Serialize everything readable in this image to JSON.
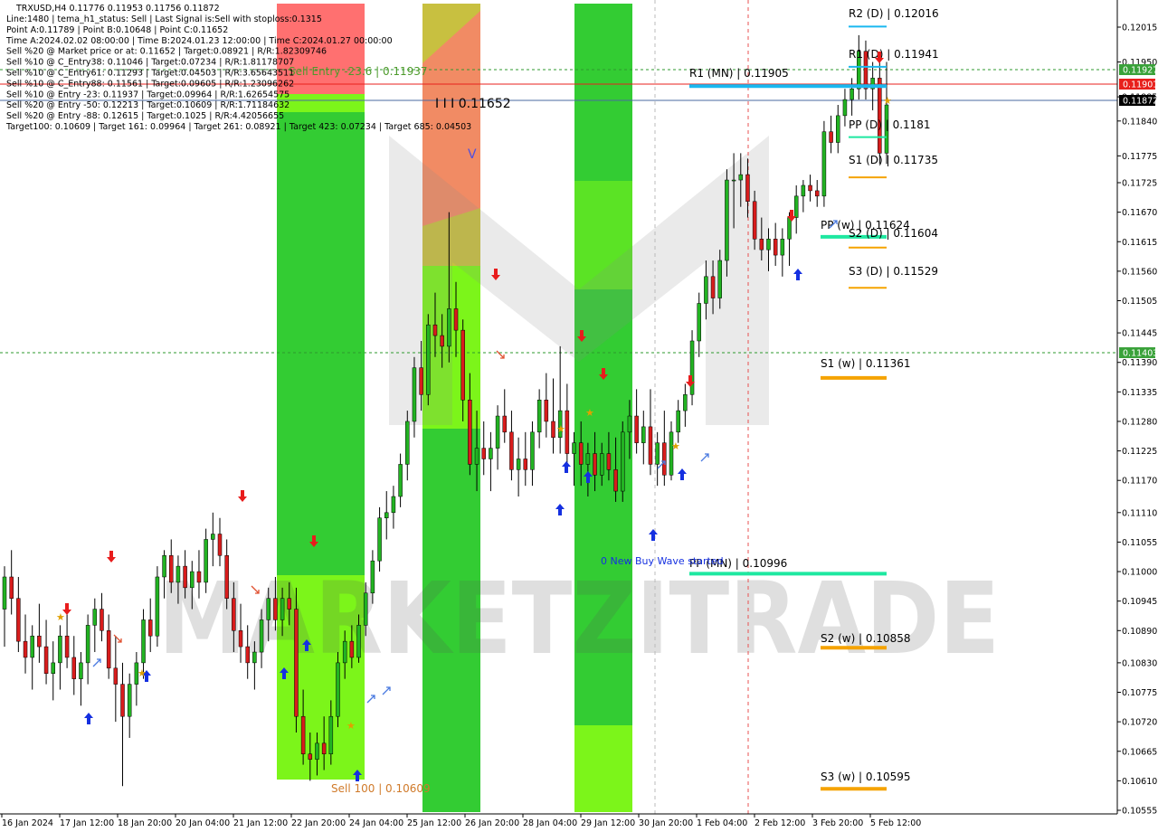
{
  "symbol_line": "TRXUSD,H4  0.11776 0.11953 0.11756 0.11872",
  "info_lines": [
    "Line:1480 | tema_h1_status: Sell | Last Signal is:Sell with stoploss:0.1315",
    "Point A:0.11789 | Point B:0.10648 | Point C:0.11652",
    "Time A:2024.02.02 08:00:00 | Time B:2024.01.23 12:00:00 | Time C:2024.01.27 00:00:00",
    "Sell %20 @ Market price or at: 0.11652 | Target:0.08921 | R/R:1.82309746",
    "Sell %10 @ C_Entry38: 0.11046 | Target:0.07234 | R/R:1.81178707",
    "Sell %10 @ C_Entry61: 0.11293 | Target:0.04503 | R/R:3.65643511",
    "Sell %10 @ C_Entry88: 0.11561 | Target:0.09605 | R/R:1.23096262",
    "Sell %10 @ Entry -23: 0.11937 | Target:0.09964 | R/R:1.62654575",
    "Sell %20 @ Entry -50: 0.12213 | Target:0.10609 | R/R:1.71184632",
    "Sell %20 @ Entry -88: 0.12615 | Target:0.1025 | R/R:4.42056655",
    "Target100: 0.10609 | Target 161: 0.09964 | Target 261: 0.08921 | Target 423: 0.07234 | Target 685: 0.04503"
  ],
  "watermark": "MARKETZITRADE",
  "annotations": {
    "sell_entry": "Sell Entry -23.6 | 0.11937",
    "c_value": "I I I 0.11652",
    "sell_100": "Sell 100 | 0.10609",
    "new_buy_wave": "0 New Buy Wave started",
    "v_marker": "V"
  },
  "levels": [
    {
      "label": "R2 (D) | 0.12016",
      "price": 0.12016,
      "color": "#1ab8f0"
    },
    {
      "label": "R1 (D) | 0.11941",
      "price": 0.11941,
      "color": "#1ab8f0"
    },
    {
      "label": "R1 (MN) | 0.11905",
      "price": 0.11905,
      "color": "#1ab8f0"
    },
    {
      "label": "PP (D) | 0.1181",
      "price": 0.1181,
      "color": "#1ee8a0"
    },
    {
      "label": "S1 (D) | 0.11735",
      "price": 0.11735,
      "color": "#f5a300"
    },
    {
      "label": "PP (w) | 0.11624",
      "price": 0.11624,
      "color": "#1ee8a0"
    },
    {
      "label": "S2 (D) | 0.11604",
      "price": 0.11604,
      "color": "#f5a300"
    },
    {
      "label": "S3 (D) | 0.11529",
      "price": 0.11529,
      "color": "#f5a300"
    },
    {
      "label": "S1 (w) | 0.11361",
      "price": 0.11361,
      "color": "#f5a300"
    },
    {
      "label": "PP (MN) | 0.10996",
      "price": 0.10996,
      "color": "#1ee8a0"
    },
    {
      "label": "S2 (w) | 0.10858",
      "price": 0.10858,
      "color": "#f5a300"
    },
    {
      "label": "S3 (w) | 0.10595",
      "price": 0.10595,
      "color": "#f5a300"
    }
  ],
  "price_tags": [
    {
      "text": "0.11927",
      "price": 0.11927,
      "color": "#3aa23a"
    },
    {
      "text": "0.11901",
      "price": 0.11901,
      "color": "#e8201c"
    },
    {
      "text": "0.11872",
      "price": 0.11872,
      "color": "#000000"
    },
    {
      "text": "0.11403",
      "price": 0.11403,
      "color": "#3aa23a"
    }
  ],
  "colors": {
    "bull": "#22b322",
    "bear": "#d81c1c",
    "up_arrow": "#1530e0",
    "down_arrow": "#e81c1c",
    "zone_green": "#33cc33",
    "zone_lime": "#7cf51a",
    "zone_red": "#ff7070",
    "zone_olive": "#c8c040",
    "hline_green": "#2e9a2e",
    "hline_red": "#e8201c",
    "hline_blue": "#4a6aa0",
    "vline_red": "#e85050"
  },
  "chart_data": {
    "type": "candlestick",
    "title": "TRXUSD,H4",
    "ylim": [
      0.10555,
      0.121
    ],
    "y_ticks": [
      "0.12015",
      "0.11950",
      "0.11885",
      "0.11840",
      "0.11775",
      "0.11725",
      "0.11670",
      "0.11615",
      "0.11560",
      "0.11505",
      "0.11445",
      "0.11390",
      "0.11335",
      "0.11280",
      "0.11225",
      "0.11170",
      "0.11110",
      "0.11055",
      "0.11000",
      "0.10945",
      "0.10890",
      "0.10830",
      "0.10775",
      "0.10720",
      "0.10665",
      "0.10610",
      "0.10555"
    ],
    "x_labels": [
      "16 Jan 2024",
      "17 Jan 12:00",
      "18 Jan 20:00",
      "20 Jan 04:00",
      "21 Jan 12:00",
      "22 Jan 20:00",
      "24 Jan 04:00",
      "25 Jan 12:00",
      "26 Jan 20:00",
      "28 Jan 04:00",
      "29 Jan 12:00",
      "30 Jan 20:00",
      "1 Feb 04:00",
      "2 Feb 12:00",
      "3 Feb 20:00",
      "5 Feb 12:00"
    ],
    "bars": [
      [
        0.1093,
        0.1101,
        0.1086,
        0.1099
      ],
      [
        0.1099,
        0.1104,
        0.1092,
        0.1095
      ],
      [
        0.1095,
        0.1099,
        0.1085,
        0.1087
      ],
      [
        0.1087,
        0.1092,
        0.1081,
        0.1084
      ],
      [
        0.1084,
        0.109,
        0.1078,
        0.1088
      ],
      [
        0.1088,
        0.1094,
        0.1083,
        0.1086
      ],
      [
        0.1086,
        0.1091,
        0.1079,
        0.1081
      ],
      [
        0.1081,
        0.1087,
        0.1076,
        0.1083
      ],
      [
        0.1083,
        0.109,
        0.1078,
        0.1088
      ],
      [
        0.1088,
        0.1092,
        0.1082,
        0.1084
      ],
      [
        0.1084,
        0.1088,
        0.1077,
        0.108
      ],
      [
        0.108,
        0.1085,
        0.1075,
        0.1083
      ],
      [
        0.1083,
        0.1092,
        0.1079,
        0.109
      ],
      [
        0.109,
        0.1095,
        0.1085,
        0.1093
      ],
      [
        0.1093,
        0.1096,
        0.1087,
        0.1089
      ],
      [
        0.1089,
        0.1092,
        0.108,
        0.1082
      ],
      [
        0.1082,
        0.1088,
        0.1072,
        0.1079
      ],
      [
        0.1079,
        0.1083,
        0.106,
        0.1073
      ],
      [
        0.1073,
        0.1081,
        0.1069,
        0.1079
      ],
      [
        0.1079,
        0.1085,
        0.1075,
        0.1083
      ],
      [
        0.1083,
        0.1093,
        0.108,
        0.1091
      ],
      [
        0.1091,
        0.1095,
        0.1085,
        0.1088
      ],
      [
        0.1088,
        0.1101,
        0.1086,
        0.1099
      ],
      [
        0.1099,
        0.1104,
        0.1095,
        0.1103
      ],
      [
        0.1103,
        0.1106,
        0.1096,
        0.1098
      ],
      [
        0.1098,
        0.1103,
        0.1094,
        0.1101
      ],
      [
        0.1101,
        0.1104,
        0.1095,
        0.1097
      ],
      [
        0.1097,
        0.1102,
        0.1093,
        0.11
      ],
      [
        0.11,
        0.1104,
        0.1095,
        0.1098
      ],
      [
        0.1098,
        0.1108,
        0.1096,
        0.1106
      ],
      [
        0.1106,
        0.1111,
        0.1101,
        0.1107
      ],
      [
        0.1107,
        0.111,
        0.1101,
        0.1103
      ],
      [
        0.1103,
        0.1106,
        0.1093,
        0.1095
      ],
      [
        0.1095,
        0.1098,
        0.1085,
        0.1089
      ],
      [
        0.1089,
        0.1094,
        0.1083,
        0.1086
      ],
      [
        0.1086,
        0.109,
        0.108,
        0.1083
      ],
      [
        0.1083,
        0.1087,
        0.1078,
        0.1085
      ],
      [
        0.1085,
        0.1093,
        0.1082,
        0.1091
      ],
      [
        0.1091,
        0.1097,
        0.1087,
        0.1095
      ],
      [
        0.1095,
        0.1099,
        0.1089,
        0.1091
      ],
      [
        0.1091,
        0.1097,
        0.1088,
        0.1095
      ],
      [
        0.1095,
        0.1098,
        0.109,
        0.1093
      ],
      [
        0.1093,
        0.1097,
        0.107,
        0.1073
      ],
      [
        0.1073,
        0.1078,
        0.1064,
        0.1066
      ],
      [
        0.1066,
        0.107,
        0.1061,
        0.1065
      ],
      [
        0.1065,
        0.107,
        0.1062,
        0.1068
      ],
      [
        0.1068,
        0.1073,
        0.1063,
        0.1066
      ],
      [
        0.1066,
        0.1076,
        0.1064,
        0.1073
      ],
      [
        0.1073,
        0.1085,
        0.1071,
        0.1083
      ],
      [
        0.1083,
        0.1089,
        0.108,
        0.1087
      ],
      [
        0.1087,
        0.109,
        0.1082,
        0.1084
      ],
      [
        0.1084,
        0.1092,
        0.1083,
        0.109
      ],
      [
        0.109,
        0.1098,
        0.1088,
        0.1096
      ],
      [
        0.1096,
        0.1104,
        0.1094,
        0.1102
      ],
      [
        0.1102,
        0.1112,
        0.11,
        0.111
      ],
      [
        0.111,
        0.1115,
        0.1106,
        0.1111
      ],
      [
        0.1111,
        0.1116,
        0.1108,
        0.1114
      ],
      [
        0.1114,
        0.1122,
        0.1112,
        0.112
      ],
      [
        0.112,
        0.113,
        0.1117,
        0.1128
      ],
      [
        0.1128,
        0.114,
        0.1125,
        0.1138
      ],
      [
        0.1138,
        0.1143,
        0.113,
        0.1133
      ],
      [
        0.1133,
        0.1148,
        0.1131,
        0.1146
      ],
      [
        0.1146,
        0.1152,
        0.114,
        0.1144
      ],
      [
        0.1144,
        0.1148,
        0.1138,
        0.1142
      ],
      [
        0.1142,
        0.1167,
        0.1139,
        0.1149
      ],
      [
        0.1149,
        0.1154,
        0.114,
        0.1145
      ],
      [
        0.1145,
        0.1147,
        0.1128,
        0.1132
      ],
      [
        0.1132,
        0.1137,
        0.1118,
        0.112
      ],
      [
        0.112,
        0.113,
        0.1115,
        0.1123
      ],
      [
        0.1123,
        0.1128,
        0.1118,
        0.1121
      ],
      [
        0.1121,
        0.1126,
        0.1115,
        0.1123
      ],
      [
        0.1123,
        0.1131,
        0.1119,
        0.1129
      ],
      [
        0.1129,
        0.1134,
        0.1124,
        0.1126
      ],
      [
        0.1126,
        0.113,
        0.1117,
        0.1119
      ],
      [
        0.1119,
        0.1125,
        0.1114,
        0.1121
      ],
      [
        0.1121,
        0.1126,
        0.1116,
        0.1119
      ],
      [
        0.1119,
        0.1128,
        0.1116,
        0.1126
      ],
      [
        0.1126,
        0.1134,
        0.1123,
        0.1132
      ],
      [
        0.1132,
        0.1137,
        0.1125,
        0.1128
      ],
      [
        0.1128,
        0.1136,
        0.1122,
        0.1125
      ],
      [
        0.1125,
        0.1142,
        0.1122,
        0.113
      ],
      [
        0.113,
        0.1135,
        0.112,
        0.1122
      ],
      [
        0.1122,
        0.1126,
        0.1116,
        0.1124
      ],
      [
        0.1124,
        0.1128,
        0.1116,
        0.112
      ],
      [
        0.112,
        0.1124,
        0.1114,
        0.1122
      ],
      [
        0.1122,
        0.1126,
        0.1115,
        0.1118
      ],
      [
        0.1118,
        0.1124,
        0.1116,
        0.1122
      ],
      [
        0.1122,
        0.1126,
        0.1117,
        0.1119
      ],
      [
        0.1119,
        0.1125,
        0.1113,
        0.1115
      ],
      [
        0.1115,
        0.1128,
        0.1113,
        0.1126
      ],
      [
        0.1126,
        0.1132,
        0.1121,
        0.1129
      ],
      [
        0.1129,
        0.1134,
        0.1122,
        0.1124
      ],
      [
        0.1124,
        0.113,
        0.112,
        0.1127
      ],
      [
        0.1127,
        0.1134,
        0.1118,
        0.112
      ],
      [
        0.112,
        0.1126,
        0.1116,
        0.1124
      ],
      [
        0.1124,
        0.113,
        0.1116,
        0.1118
      ],
      [
        0.1118,
        0.1128,
        0.1117,
        0.1126
      ],
      [
        0.1126,
        0.1132,
        0.1124,
        0.113
      ],
      [
        0.113,
        0.1135,
        0.1127,
        0.1133
      ],
      [
        0.1133,
        0.1145,
        0.1131,
        0.1143
      ],
      [
        0.1143,
        0.1152,
        0.114,
        0.115
      ],
      [
        0.115,
        0.1158,
        0.1147,
        0.1155
      ],
      [
        0.1155,
        0.1158,
        0.1148,
        0.1151
      ],
      [
        0.1151,
        0.116,
        0.1149,
        0.1158
      ],
      [
        0.1158,
        0.1175,
        0.1155,
        0.1173
      ],
      [
        0.1173,
        0.1178,
        0.1164,
        0.1173
      ],
      [
        0.1173,
        0.1178,
        0.1168,
        0.1174
      ],
      [
        0.1174,
        0.1177,
        0.1166,
        0.1169
      ],
      [
        0.1169,
        0.1171,
        0.116,
        0.1162
      ],
      [
        0.1162,
        0.1166,
        0.1158,
        0.116
      ],
      [
        0.116,
        0.1164,
        0.1156,
        0.1162
      ],
      [
        0.1162,
        0.1165,
        0.1157,
        0.1159
      ],
      [
        0.1159,
        0.1164,
        0.1155,
        0.1162
      ],
      [
        0.1162,
        0.1167,
        0.1157,
        0.1166
      ],
      [
        0.1166,
        0.1172,
        0.1163,
        0.117
      ],
      [
        0.117,
        0.1173,
        0.1167,
        0.1172
      ],
      [
        0.1172,
        0.1174,
        0.1169,
        0.1171
      ],
      [
        0.1171,
        0.1173,
        0.1168,
        0.117
      ],
      [
        0.117,
        0.1184,
        0.1168,
        0.1182
      ],
      [
        0.1182,
        0.1185,
        0.1178,
        0.118
      ],
      [
        0.118,
        0.1187,
        0.1178,
        0.1185
      ],
      [
        0.1185,
        0.119,
        0.1183,
        0.1188
      ],
      [
        0.1188,
        0.1192,
        0.1185,
        0.119
      ],
      [
        0.119,
        0.12,
        0.1188,
        0.1197
      ],
      [
        0.1197,
        0.1199,
        0.1188,
        0.119
      ],
      [
        0.119,
        0.1195,
        0.1186,
        0.1192
      ],
      [
        0.1192,
        0.1195,
        0.1176,
        0.1178
      ],
      [
        0.1178,
        0.1195,
        0.1176,
        0.1187
      ]
    ]
  }
}
